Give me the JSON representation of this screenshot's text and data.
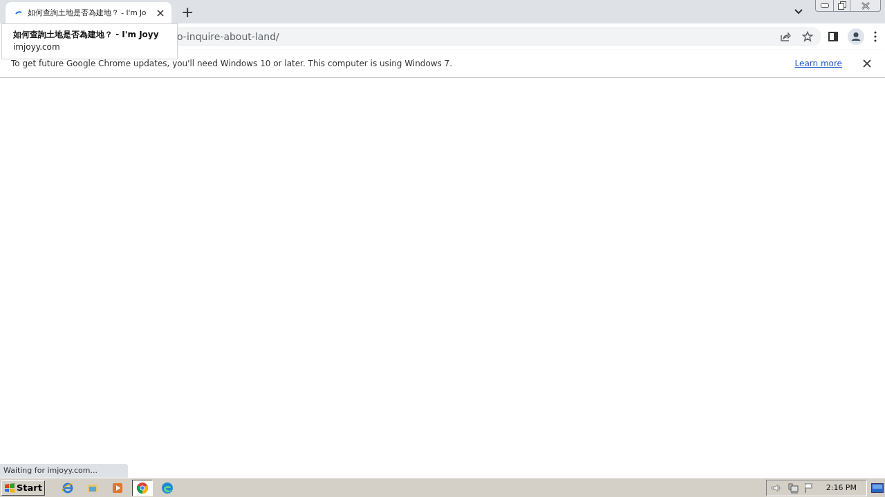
{
  "tab": {
    "title": "如何查詢土地是否為建地？ - I'm Jo",
    "loading": true
  },
  "new_tab_button": "+",
  "tab_tooltip": {
    "title": "如何查詢土地是否為建地？ - I'm Joyy",
    "domain": "imjoyy.com"
  },
  "address_bar": {
    "url": "o-inquire-about-land/"
  },
  "infobar": {
    "message": "To get future Google Chrome updates, you'll need Windows 10 or later. This computer is using Windows 7.",
    "link": "Learn more"
  },
  "status_bubble": "Waiting for imjoyy.com...",
  "taskbar": {
    "start": "Start",
    "apps": [
      {
        "kind": "ie",
        "selected": false
      },
      {
        "kind": "folder",
        "selected": false
      },
      {
        "kind": "media",
        "selected": false
      },
      {
        "kind": "chrome",
        "selected": true
      },
      {
        "kind": "edge",
        "selected": false
      }
    ],
    "clock": "2:16 PM"
  }
}
